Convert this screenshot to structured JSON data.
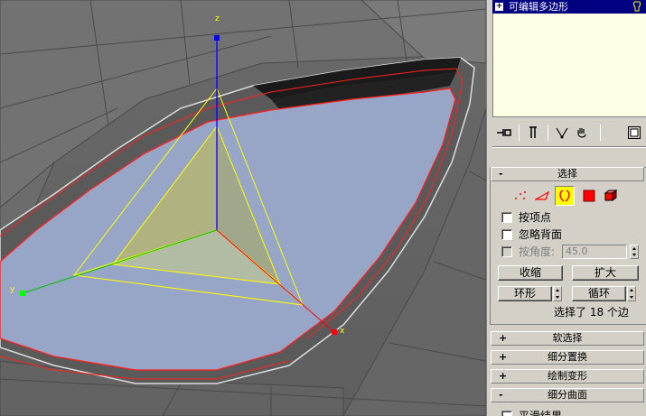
{
  "modifier_stack": {
    "toggle": "+",
    "title": "可编辑多边形"
  },
  "viewport": {
    "gizmo_axes": [
      "z",
      "y",
      "x"
    ],
    "colors": {
      "x_axis": "#ff0000",
      "y_axis": "#00c000",
      "z_axis": "#0000ff",
      "gizmo": "#ffff00",
      "selected_face": "#97a6c6",
      "edge_highlight": "#ff2020"
    }
  },
  "stack_toolbar": {
    "icons": [
      "pin-stack-icon",
      "show-end-result-icon",
      "make-unique-icon",
      "remove-modifier-icon",
      "configure-modifier-sets-icon"
    ]
  },
  "selection_rollout": {
    "sign": "-",
    "title": "选择",
    "levels": [
      "vertex-icon",
      "edge-icon",
      "border-icon",
      "polygon-icon",
      "element-icon"
    ],
    "active_level": "border-icon",
    "by_vertex_label": "按项点",
    "ignore_backfacing_label": "忽略背面",
    "by_angle_label": "按角度:",
    "by_angle_value": "45.0",
    "shrink_label": "收缩",
    "grow_label": "扩大",
    "ring_label": "环形",
    "loop_label": "循环",
    "status_text": "选择了 18 个边"
  },
  "rollouts": [
    {
      "sign": "+",
      "title": "软选择"
    },
    {
      "sign": "+",
      "title": "细分置换"
    },
    {
      "sign": "+",
      "title": "绘制变形"
    },
    {
      "sign": "-",
      "title": "细分曲面"
    }
  ],
  "cut_text": "平滑结果"
}
